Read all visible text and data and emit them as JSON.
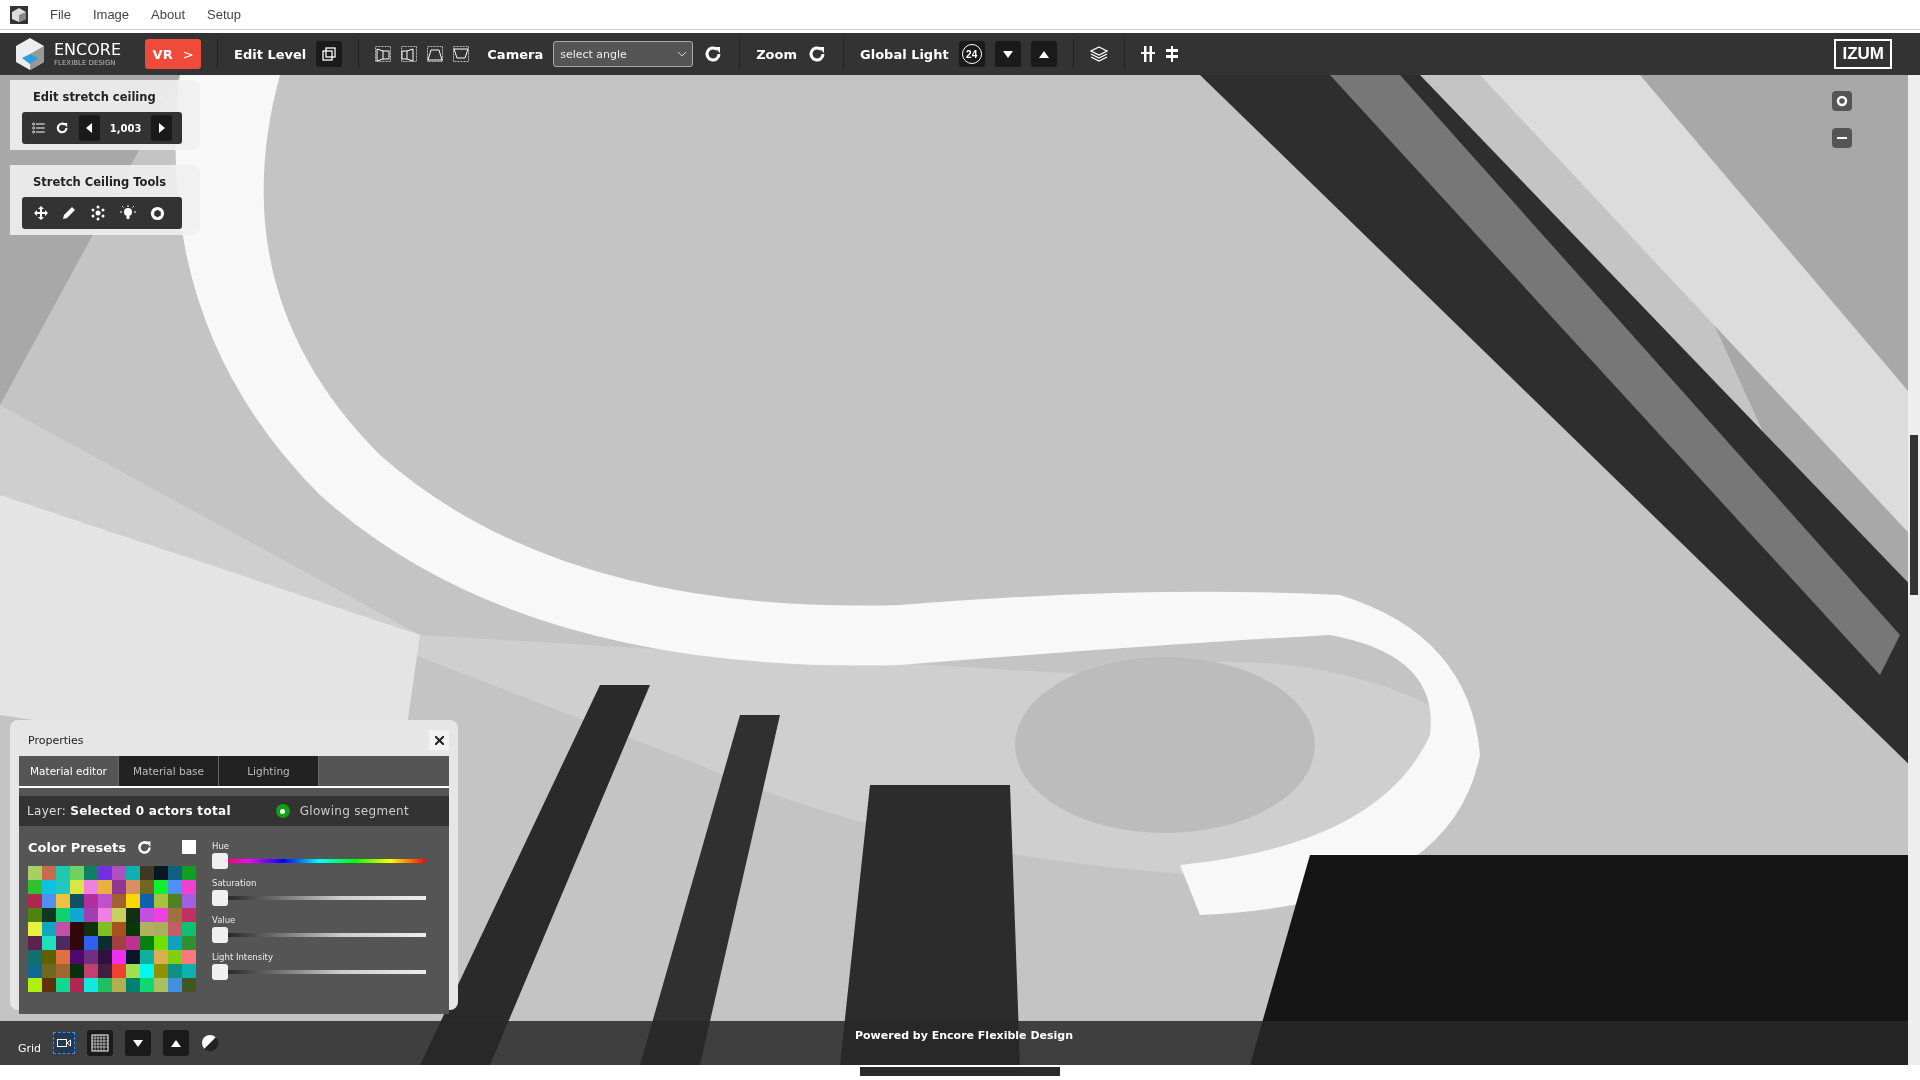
{
  "menu_bar": {
    "items": [
      "File",
      "Image",
      "About",
      "Setup"
    ]
  },
  "toolbar": {
    "logo": {
      "title": "ENCORE",
      "subtitle": "FLEXIBLE DESIGN"
    },
    "vr_button": {
      "label": "VR",
      "arrow": ">"
    },
    "edit_level": "Edit Level",
    "camera": {
      "label": "Camera",
      "select": {
        "value": "select angle"
      }
    },
    "zoom": "Zoom",
    "global_light": {
      "label": "Global Light",
      "badge": "24"
    },
    "brand": "IZUM"
  },
  "edit_panel": {
    "title": "Edit stretch ceiling",
    "value": "1,003"
  },
  "tools_panel": {
    "title": "Stretch Ceiling Tools"
  },
  "properties": {
    "title": "Properties",
    "tabs": [
      {
        "label": "Material editor",
        "selected": true
      },
      {
        "label": "Material base",
        "selected": false
      },
      {
        "label": "Lighting",
        "selected": false
      }
    ],
    "layer": "Layer: **Selected 0 actors total**",
    "glowing_segment": {
      "label": "Glowing segment",
      "on": true
    },
    "color_presets": {
      "title": "Color Presets",
      "swatch_rows": [
        {
          "colors": [
            {
              "color": "#a8d060"
            },
            {
              "color": "#c86a50"
            },
            {
              "color": "#20c8b0"
            },
            {
              "color": "#70d060"
            },
            {
              "color": "#108060"
            },
            {
              "color": "#7030e0"
            },
            {
              "color": "#b050c0"
            },
            {
              "color": "#10b0b0"
            },
            {
              "color": "#403820"
            },
            {
              "color": "#081820"
            },
            {
              "color": "#106080"
            },
            {
              "color": "#10a020"
            }
          ]
        },
        {
          "colors": [
            {
              "color": "#30c030"
            },
            {
              "color": "#10c0e0"
            },
            {
              "color": "#20c8c0"
            },
            {
              "color": "#d8e840"
            },
            {
              "color": "#f080e0"
            },
            {
              "color": "#e8b040"
            },
            {
              "color": "#903890"
            },
            {
              "color": "#d89060"
            },
            {
              "color": "#706820"
            },
            {
              "color": "#10f030"
            },
            {
              "color": "#5090f0"
            },
            {
              "color": "#f040d0"
            }
          ]
        },
        {
          "colors": [
            {
              "color": "#b02850"
            },
            {
              "color": "#5090f0"
            },
            {
              "color": "#f0c040"
            },
            {
              "color": "#105060"
            },
            {
              "color": "#b030a0"
            },
            {
              "color": "#c050d0"
            },
            {
              "color": "#a06030"
            },
            {
              "color": "#f8d800"
            },
            {
              "color": "#1060b0"
            },
            {
              "color": "#a8c040"
            },
            {
              "color": "#508020"
            },
            {
              "color": "#a060e0"
            }
          ]
        },
        {
          "colors": [
            {
              "color": "#508010"
            },
            {
              "color": "#103820"
            },
            {
              "color": "#10d070"
            },
            {
              "color": "#10a8d0"
            },
            {
              "color": "#a040b0"
            },
            {
              "color": "#f080e0"
            },
            {
              "color": "#c8d060"
            },
            {
              "color": "#103010"
            },
            {
              "color": "#c050e0"
            },
            {
              "color": "#f040e0"
            },
            {
              "color": "#a07040"
            },
            {
              "color": "#c03060"
            }
          ]
        },
        {
          "colors": [
            {
              "color": "#e8f040"
            },
            {
              "color": "#10a8c0"
            },
            {
              "color": "#c050a8"
            },
            {
              "color": "#300808"
            },
            {
              "color": "#103010"
            },
            {
              "color": "#80c020"
            },
            {
              "color": "#a85020"
            },
            {
              "color": "#083808"
            },
            {
              "color": "#b0b060"
            },
            {
              "color": "#a8b060"
            },
            {
              "color": "#c06060"
            },
            {
              "color": "#10c070"
            }
          ]
        },
        {
          "colors": [
            {
              "color": "#602050"
            },
            {
              "color": "#20e0c0"
            },
            {
              "color": "#502860"
            },
            {
              "color": "#300809"
            },
            {
              "color": "#3060f0"
            },
            {
              "color": "#083030"
            },
            {
              "color": "#a04040"
            },
            {
              "color": "#c03090"
            },
            {
              "color": "#088010"
            },
            {
              "color": "#70e000"
            },
            {
              "color": "#10a0c0"
            },
            {
              "color": "#309030"
            }
          ]
        },
        {
          "colors": [
            {
              "color": "#107070"
            },
            {
              "color": "#606000"
            },
            {
              "color": "#e07040"
            },
            {
              "color": "#500870"
            },
            {
              "color": "#703080"
            },
            {
              "color": "#301040"
            },
            {
              "color": "#f030f0"
            },
            {
              "color": "#081828"
            },
            {
              "color": "#10b0a0"
            },
            {
              "color": "#d8b050"
            },
            {
              "color": "#80d010"
            },
            {
              "color": "#f87880"
            }
          ]
        },
        {
          "colors": [
            {
              "color": "#106890"
            },
            {
              "color": "#706821"
            },
            {
              "color": "#a06830"
            },
            {
              "color": "#083010"
            },
            {
              "color": "#c04070"
            },
            {
              "color": "#402040"
            },
            {
              "color": "#f04030"
            },
            {
              "color": "#a0e050"
            },
            {
              "color": "#00f8f0"
            },
            {
              "color": "#909000"
            },
            {
              "color": "#109080"
            },
            {
              "color": "#10b0b1"
            }
          ]
        },
        {
          "colors": [
            {
              "color": "#b0f010"
            },
            {
              "color": "#603008"
            },
            {
              "color": "#10d890"
            },
            {
              "color": "#b02851"
            },
            {
              "color": "#10e8e0"
            },
            {
              "color": "#20c060"
            },
            {
              "color": "#b0b050"
            },
            {
              "color": "#008070"
            },
            {
              "color": "#10d870"
            },
            {
              "color": "#a8c060"
            },
            {
              "color": "#4090e0"
            },
            {
              "color": "#405820"
            }
          ]
        }
      ]
    },
    "sliders": [
      {
        "kind": "hue",
        "name": "Hue",
        "level": 0
      },
      {
        "kind": "gray",
        "name": "Saturation",
        "level": 0
      },
      {
        "kind": "gray",
        "name": "Value",
        "level": 0
      },
      {
        "kind": "gray",
        "name": "Light Intensity",
        "level": 0
      }
    ]
  },
  "bottom_bar": {
    "grid_label": "Grid",
    "credit": "Powered by Encore Flexible Design"
  }
}
